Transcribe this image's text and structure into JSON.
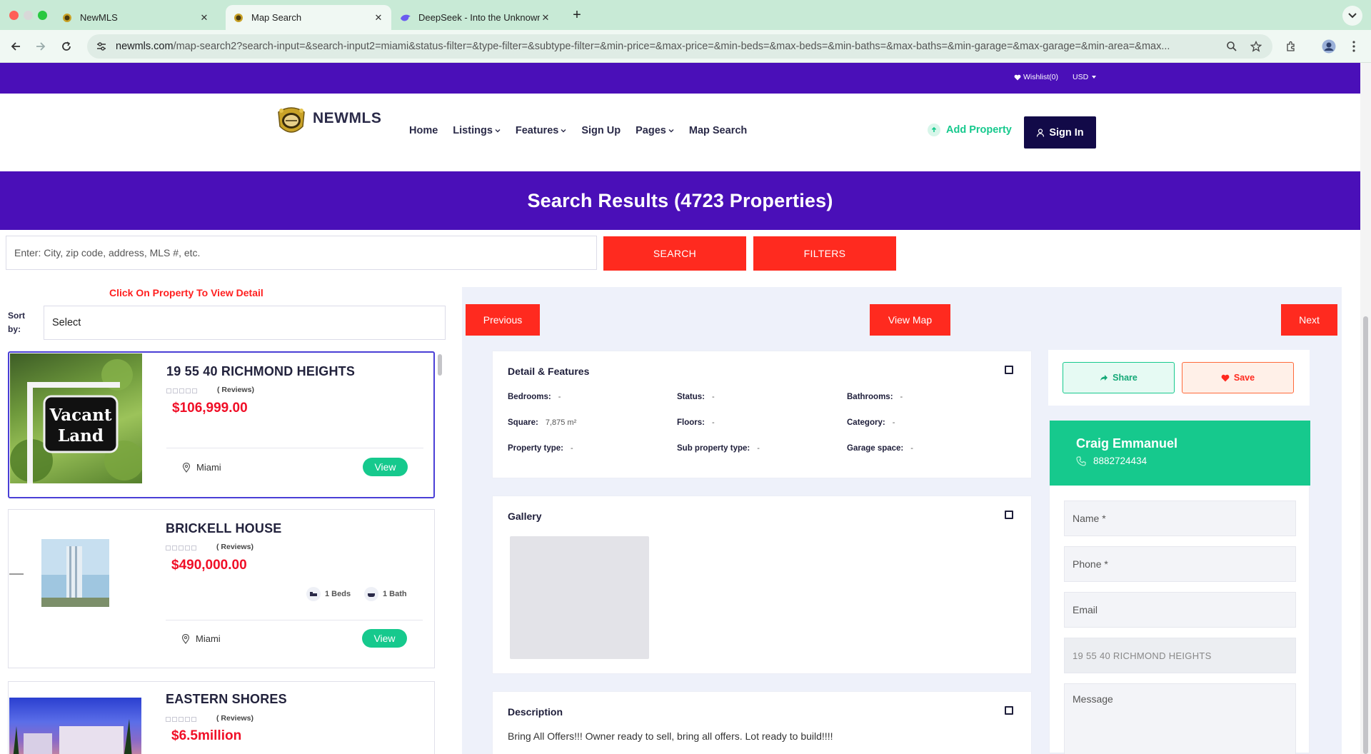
{
  "browser": {
    "tabs": [
      {
        "title": "NewMLS",
        "favicon": "newmls-crest-icon",
        "active": false
      },
      {
        "title": "Map Search",
        "favicon": "newmls-crest-icon",
        "active": true
      },
      {
        "title": "DeepSeek - Into the Unknown",
        "favicon": "deepseek-whale-icon",
        "active": false
      }
    ],
    "url_host": "newmls.com",
    "url_path": "/map-search2?search-input=&search-input2=miami&status-filter=&type-filter=&subtype-filter=&min-price=&max-price=&min-beds=&max-beds=&min-baths=&max-baths=&min-garage=&max-garage=&min-area=&max..."
  },
  "site": {
    "topbar": {
      "wishlist": "Wishlist(0)",
      "currency": "USD"
    },
    "brand": "NEWMLS",
    "nav": [
      {
        "label": "Home",
        "dropdown": false
      },
      {
        "label": "Listings",
        "dropdown": true
      },
      {
        "label": "Features",
        "dropdown": true
      },
      {
        "label": "Sign Up",
        "dropdown": false
      },
      {
        "label": "Pages",
        "dropdown": true
      },
      {
        "label": "Map Search",
        "dropdown": false
      }
    ],
    "add_property": "Add Property",
    "sign_in": "Sign In",
    "banner_title": "Search Results (4723 Properties)",
    "search": {
      "placeholder": "Enter: City, zip code, address, MLS #, etc.",
      "search_label": "SEARCH",
      "filters_label": "FILTERS"
    },
    "colors": {
      "brand_purple": "#4a0fb8",
      "accent_red": "#ff2a1f",
      "accent_green": "#16c98d",
      "price_red": "#f00f27",
      "navy": "#120a48"
    }
  },
  "listing": {
    "hint": "Click On Property To View Detail",
    "sort_label": "Sort by:",
    "sort_value": "Select",
    "cards": [
      {
        "title": "19 55 40 RICHMOND HEIGHTS",
        "reviews": "( Reviews)",
        "price": "$106,999.00",
        "location": "Miami",
        "view": "View",
        "sign_line1": "Vacant",
        "sign_line2": "Land"
      },
      {
        "title": "BRICKELL HOUSE",
        "reviews": "( Reviews)",
        "price": "$490,000.00",
        "location": "Miami",
        "view": "View",
        "beds": "1 Beds",
        "baths": "1 Bath"
      },
      {
        "title": "EASTERN SHORES",
        "reviews": "( Reviews)",
        "price": "$6.5million"
      }
    ]
  },
  "detail": {
    "prev": "Previous",
    "view_map": "View Map",
    "next": "Next",
    "features_title": "Detail & Features",
    "features": [
      {
        "label": "Bedrooms:",
        "value": "-"
      },
      {
        "label": "Status:",
        "value": "-"
      },
      {
        "label": "Bathrooms:",
        "value": "-"
      },
      {
        "label": "Square:",
        "value": "7,875 m²"
      },
      {
        "label": "Floors:",
        "value": "-"
      },
      {
        "label": "Category:",
        "value": "-"
      },
      {
        "label": "Property type:",
        "value": "-"
      },
      {
        "label": "Sub property type:",
        "value": "-"
      },
      {
        "label": "Garage space:",
        "value": "-"
      }
    ],
    "gallery_title": "Gallery",
    "description_title": "Description",
    "description": "Bring All Offers!!! Owner ready to sell, bring all offers. Lot ready to build!!!!",
    "share": "Share",
    "save": "Save",
    "agent": {
      "name": "Craig Emmanuel",
      "phone": "8882724434"
    },
    "form": {
      "name_ph": "Name *",
      "phone_ph": "Phone *",
      "email_ph": "Email",
      "property_value": "19 55 40 RICHMOND HEIGHTS",
      "message_ph": "Message"
    }
  }
}
